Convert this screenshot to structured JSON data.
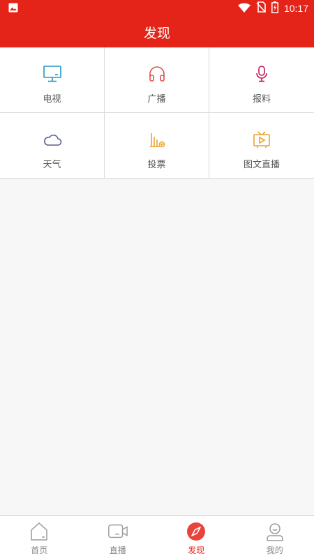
{
  "status_bar": {
    "time": "10:17"
  },
  "header": {
    "title": "发现"
  },
  "grid": [
    {
      "label": "电视",
      "icon": "tv-monitor-icon",
      "color": "#2196c6"
    },
    {
      "label": "广播",
      "icon": "headphones-icon",
      "color": "#e0504a"
    },
    {
      "label": "报料",
      "icon": "microphone-icon",
      "color": "#c2185b"
    },
    {
      "label": "天气",
      "icon": "cloud-icon",
      "color": "#5a5f8f"
    },
    {
      "label": "投票",
      "icon": "bar-chart-icon",
      "color": "#e9a431"
    },
    {
      "label": "图文直播",
      "icon": "tv-play-icon",
      "color": "#e9a431"
    }
  ],
  "tabbar": [
    {
      "label": "首页",
      "icon": "home-icon",
      "active": false
    },
    {
      "label": "直播",
      "icon": "video-camera-icon",
      "active": false
    },
    {
      "label": "发现",
      "icon": "compass-icon",
      "active": true
    },
    {
      "label": "我的",
      "icon": "user-icon",
      "active": false
    }
  ],
  "colors": {
    "brand": "#e42419",
    "divider": "#d9d9d9",
    "inactive_tab": "#888888"
  }
}
